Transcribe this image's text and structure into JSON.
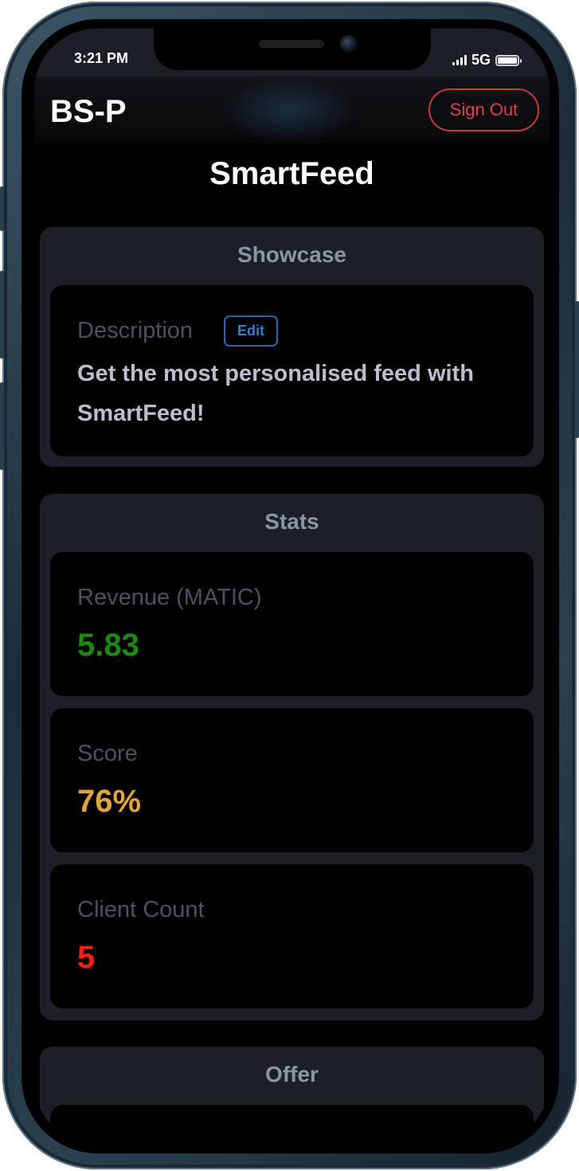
{
  "status_bar": {
    "time": "3:21 PM",
    "network": "5G"
  },
  "header": {
    "brand": "BS-P",
    "sign_out_label": "Sign Out"
  },
  "page": {
    "title": "SmartFeed"
  },
  "showcase": {
    "title": "Showcase",
    "description_label": "Description",
    "edit_label": "Edit",
    "description_text": "Get the most personalised feed with SmartFeed!"
  },
  "stats": {
    "title": "Stats",
    "items": [
      {
        "label": "Revenue (MATIC)",
        "value": "5.83",
        "color": "#1b8a12"
      },
      {
        "label": "Score",
        "value": "76%",
        "color": "#e0a63c"
      },
      {
        "label": "Client Count",
        "value": "5",
        "color": "#f2211b"
      }
    ]
  },
  "offer": {
    "title": "Offer"
  },
  "colors": {
    "background": "#000000",
    "surface": "#1b1f26",
    "sign_out": "#d8434a",
    "edit": "#3b7bd4"
  }
}
